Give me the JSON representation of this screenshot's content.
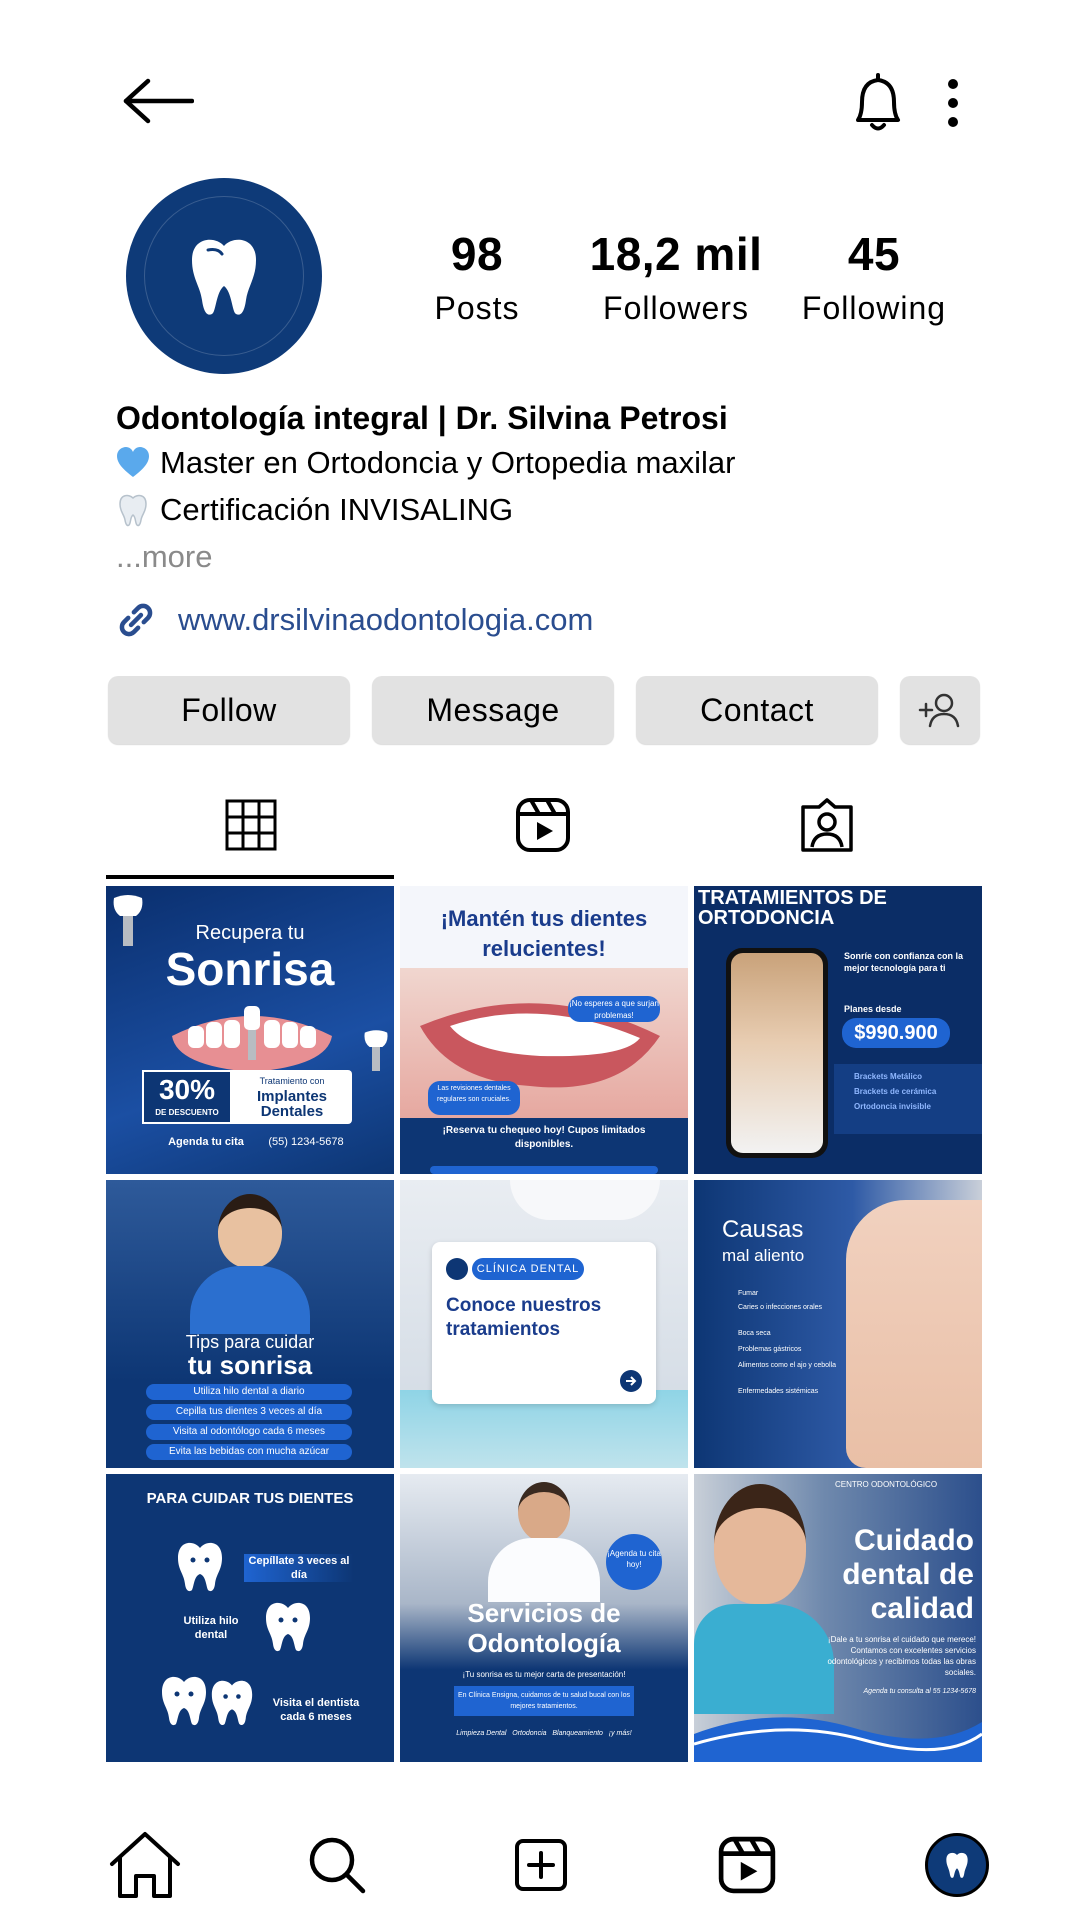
{
  "header": {
    "back_icon": "arrow-left-icon",
    "bell_icon": "bell-icon",
    "more_icon": "vertical-dots-icon"
  },
  "profile": {
    "avatar_icon": "tooth-icon",
    "stats": [
      {
        "value": "98",
        "label": "Posts"
      },
      {
        "value": "18,2 mil",
        "label": "Followers"
      },
      {
        "value": "45",
        "label": "Following"
      }
    ],
    "name": "Odontología integral | Dr. Silvina Petrosi",
    "bio_lines": [
      "Master en Ortodoncia y Ortopedia maxilar",
      "Certificación INVISALING"
    ],
    "more_label": "...more",
    "website": "www.drsilvinaodontologia.com"
  },
  "actions": {
    "follow": "Follow",
    "message": "Message",
    "contact": "Contact",
    "add_user_icon": "add-user-icon"
  },
  "tabs": [
    "grid-icon",
    "reels-icon",
    "tagged-icon"
  ],
  "posts": {
    "p1": {
      "line1": "Recupera tu",
      "line2": "Sonrisa",
      "discount": "30%",
      "discount_sub": "DE DESCUENTO",
      "promo_small": "Tratamiento con",
      "promo_big": "Implantes Dentales",
      "cta": "Agenda tu cita",
      "phone": "(55) 1234-5678"
    },
    "p2": {
      "title": "¡Mantén tus dientes relucientes!",
      "bubble1": "¡No esperes a que surjan problemas!",
      "bubble2": "Las revisiones dentales regulares son cruciales.",
      "footer": "¡Reserva tu chequeo hoy! Cupos limitados disponibles."
    },
    "p3": {
      "title": "TRATAMIENTOS DE ORTODONCIA",
      "text": "Sonríe con confianza con la mejor tecnología para ti",
      "plans": "Planes desde",
      "price": "$990.900",
      "items": [
        "Brackets Metálico",
        "Brackets de cerámica",
        "Ortodoncia invisible"
      ]
    },
    "p4": {
      "line1": "Tips para cuidar",
      "line2": "tu sonrisa",
      "tips": [
        "Utiliza hilo dental a diario",
        "Cepilla tus dientes 3 veces al día",
        "Visita al odontólogo cada 6 meses",
        "Evita las bebidas con mucha azúcar"
      ]
    },
    "p5": {
      "tag": "CLÍNICA DENTAL",
      "title": "Conoce nuestros tratamientos"
    },
    "p6": {
      "line1": "Causas",
      "line2": "mal aliento",
      "items": [
        "Fumar",
        "Caries o infecciones orales",
        "Boca seca",
        "Problemas gástricos",
        "Alimentos como el ajo y cebolla",
        "Enfermedades sistémicas"
      ]
    },
    "p7": {
      "title": "PARA CUIDAR TUS DIENTES",
      "tip1": "Cepíllate 3 veces al día",
      "tip2": "Utiliza hilo dental",
      "tip3": "Visita el dentista cada 6 meses"
    },
    "p8": {
      "badge": "¡Agenda tu cita hoy!",
      "title": "Servicios de Odontología",
      "sub": "¡Tu sonrisa es tu mejor carta de presentación!",
      "box": "En Clínica Ensigna, cuidamos de tu salud bucal con los mejores tratamientos.",
      "services": "Limpieza Dental   Ortodoncia   Blanqueamiento   ¡y más!"
    },
    "p9": {
      "top": "CENTRO ODONTOLÓGICO",
      "title": "Cuidado dental de calidad",
      "text": "¡Dale a tu sonrisa el cuidado que merece! Contamos con excelentes servicios odontológicos y recibimos todas las obras sociales.",
      "cta": "Agenda tu consulta al 55 1234-5678"
    }
  },
  "bottom_nav": [
    "home-icon",
    "search-icon",
    "add-post-icon",
    "reels-icon",
    "profile-avatar"
  ],
  "colors": {
    "brand_navy": "#0e3a78",
    "link": "#2a4d8f",
    "button_bg": "#e2e2e2",
    "accent_blue": "#1f64d1"
  }
}
